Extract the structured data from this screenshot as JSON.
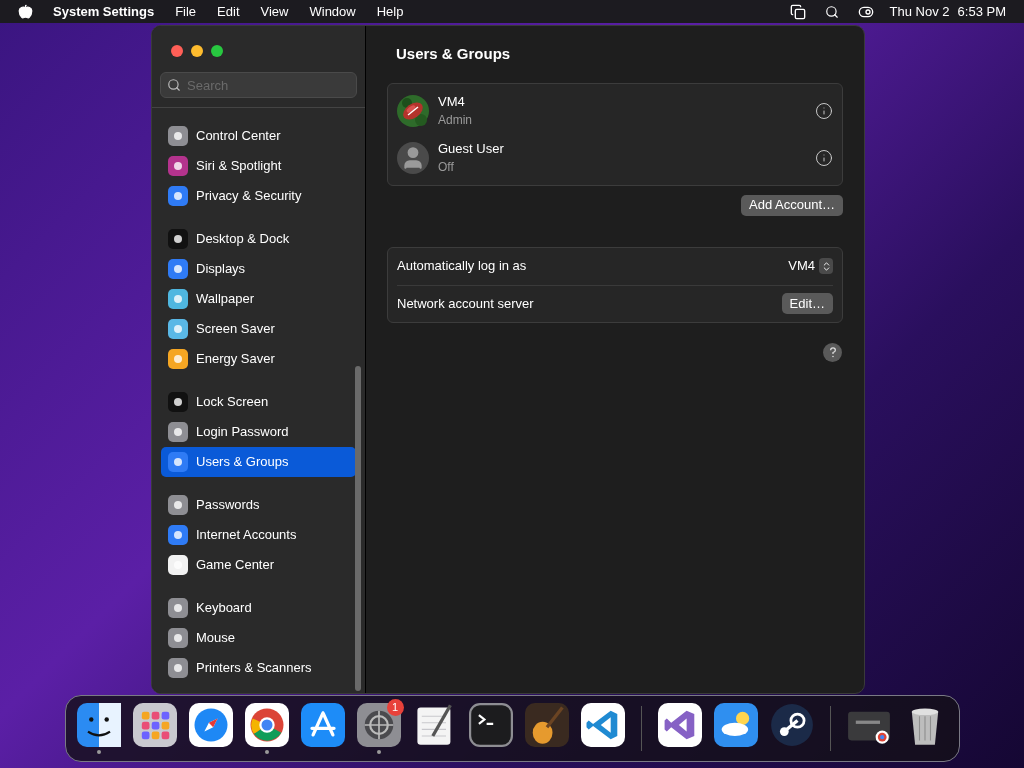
{
  "menu_bar": {
    "app_name": "System Settings",
    "menus": [
      "File",
      "Edit",
      "View",
      "Window",
      "Help"
    ],
    "date": "Thu Nov 2",
    "time": "6:53 PM"
  },
  "sidebar": {
    "search": {
      "placeholder": "Search"
    },
    "groups": [
      [
        {
          "label": "Control Center",
          "color": "#8e8e93",
          "selected": false
        },
        {
          "label": "Siri & Spotlight",
          "color": "#b4338d",
          "selected": false
        },
        {
          "label": "Privacy & Security",
          "color": "#2f7bf5",
          "selected": false
        }
      ],
      [
        {
          "label": "Desktop & Dock",
          "color": "#111111",
          "selected": false
        },
        {
          "label": "Displays",
          "color": "#2f7bf5",
          "selected": false
        },
        {
          "label": "Wallpaper",
          "color": "#4fb7e0",
          "selected": false
        },
        {
          "label": "Screen Saver",
          "color": "#5ab8e6",
          "selected": false
        },
        {
          "label": "Energy Saver",
          "color": "#f5a623",
          "selected": false
        }
      ],
      [
        {
          "label": "Lock Screen",
          "color": "#111111",
          "selected": false
        },
        {
          "label": "Login Password",
          "color": "#8e8e93",
          "selected": false
        },
        {
          "label": "Users & Groups",
          "color": "#2f7bf5",
          "selected": true
        }
      ],
      [
        {
          "label": "Passwords",
          "color": "#8e8e93",
          "selected": false
        },
        {
          "label": "Internet Accounts",
          "color": "#2f7bf5",
          "selected": false
        },
        {
          "label": "Game Center",
          "color": "#f2f2f2",
          "selected": false
        }
      ],
      [
        {
          "label": "Keyboard",
          "color": "#8e8e93",
          "selected": false
        },
        {
          "label": "Mouse",
          "color": "#8e8e93",
          "selected": false
        },
        {
          "label": "Printers & Scanners",
          "color": "#8e8e93",
          "selected": false
        }
      ]
    ]
  },
  "main": {
    "title": "Users & Groups",
    "users": [
      {
        "name": "VM4",
        "role": "Admin",
        "kind": "picture"
      },
      {
        "name": "Guest User",
        "role": "Off",
        "kind": "silhouette"
      }
    ],
    "add_button": "Add Account…",
    "settings": [
      {
        "kind": "popup",
        "label": "Automatically log in as",
        "value": "VM4"
      },
      {
        "kind": "button",
        "label": "Network account server",
        "value": "Edit…"
      }
    ]
  },
  "dock": {
    "groups": [
      [
        {
          "running": true
        },
        {
          "running": false
        },
        {
          "running": false
        },
        {
          "running": true
        },
        {
          "running": false
        },
        {
          "running": true,
          "badge": "1"
        },
        {
          "running": false
        },
        {
          "running": false
        },
        {
          "running": false
        },
        {
          "running": false
        }
      ],
      [
        {
          "running": false
        },
        {
          "running": false
        },
        {
          "running": false
        }
      ],
      [
        {
          "running": false
        },
        {
          "running": false
        }
      ]
    ]
  }
}
